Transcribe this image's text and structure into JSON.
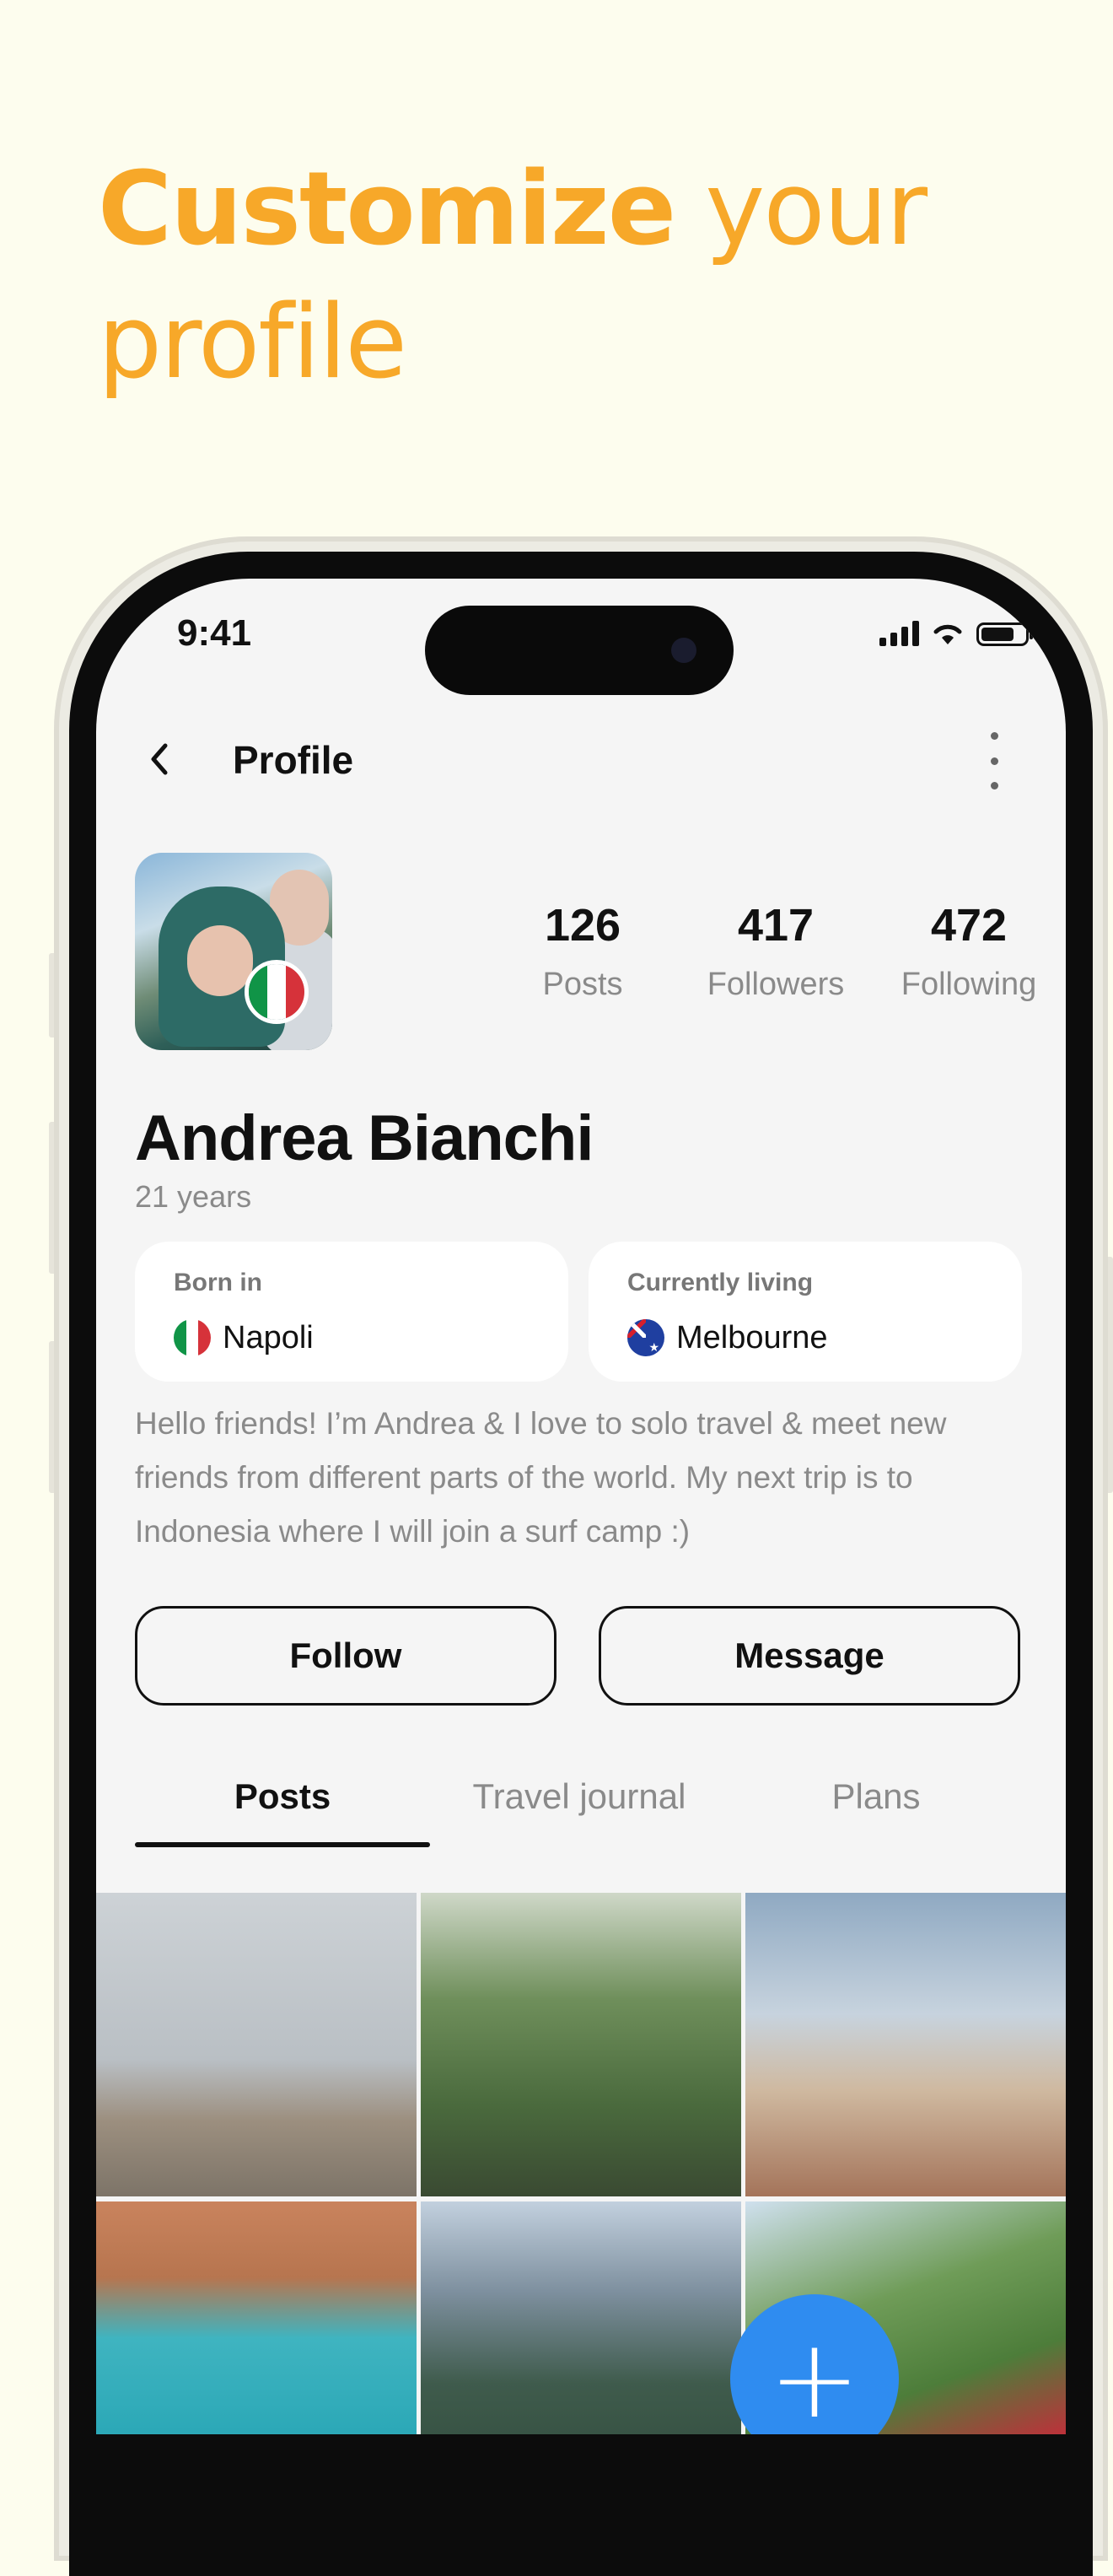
{
  "headline": {
    "bold": "Customize",
    "rest": " your",
    "line2": "profile"
  },
  "status_bar": {
    "time": "9:41"
  },
  "nav": {
    "title": "Profile"
  },
  "profile": {
    "name": "Andrea Bianchi",
    "age": "21 years",
    "stats": [
      {
        "value": "126",
        "label": "Posts"
      },
      {
        "value": "417",
        "label": "Followers"
      },
      {
        "value": "472",
        "label": "Following"
      }
    ],
    "born_in": {
      "caption": "Born in",
      "value": "Napoli"
    },
    "currently_living": {
      "caption": "Currently living",
      "value": "Melbourne"
    },
    "bio": "Hello friends! I’m Andrea & I love to solo travel & meet new friends from different parts of the world. My next trip is to Indonesia where I will join a surf camp :)"
  },
  "actions": {
    "follow": "Follow",
    "message": "Message"
  },
  "tabs": [
    {
      "label": "Posts",
      "active": true
    },
    {
      "label": "Travel journal",
      "active": false
    },
    {
      "label": "Plans",
      "active": false
    }
  ],
  "fab": {
    "icon": "plus-icon",
    "label": "+"
  },
  "colors": {
    "accent": "#f7a829",
    "fab": "#2f8cf0",
    "background": "#fdfdee"
  }
}
